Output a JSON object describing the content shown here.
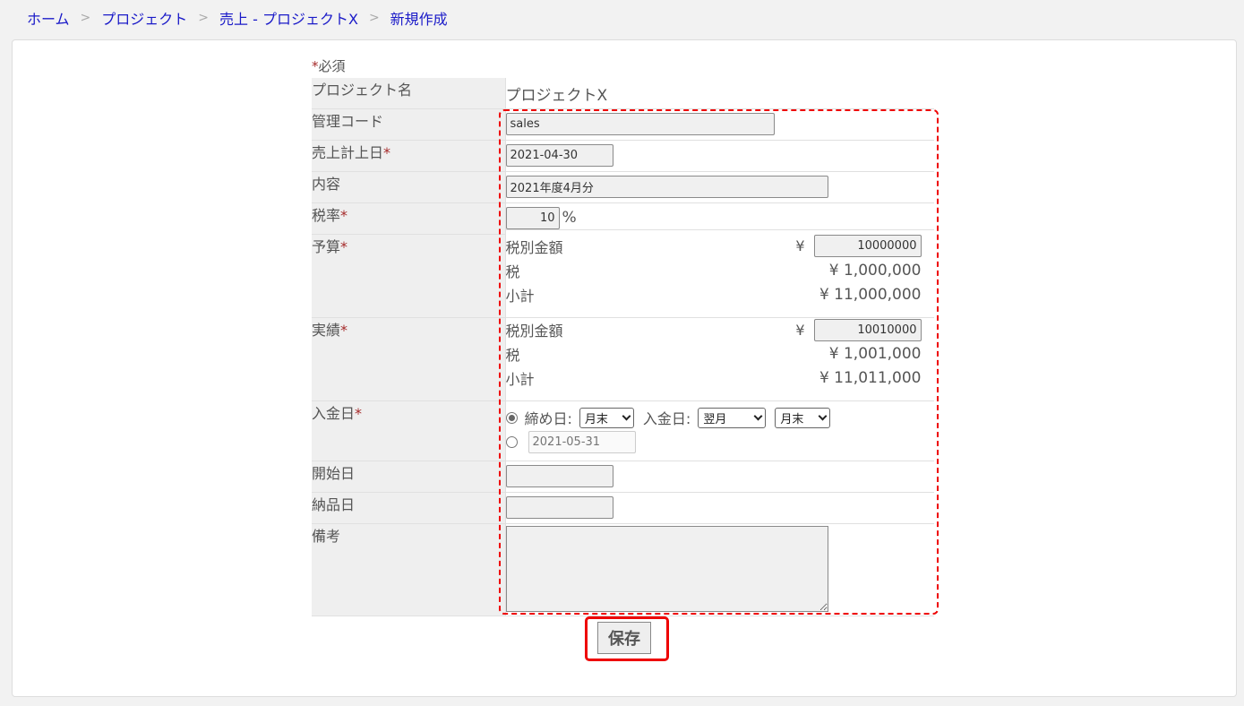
{
  "breadcrumb": {
    "items": [
      "ホーム",
      "プロジェクト",
      "売上 - プロジェクトX",
      "新規作成"
    ],
    "separator": ">"
  },
  "form": {
    "required_mark": "*",
    "required_note": "必須",
    "project_name": {
      "label": "プロジェクト名",
      "value": "プロジェクトX"
    },
    "management_code": {
      "label": "管理コード",
      "value": "sales"
    },
    "sales_date": {
      "label": "売上計上日",
      "value": "2021-04-30"
    },
    "content": {
      "label": "内容",
      "value": "2021年度4月分"
    },
    "tax_rate": {
      "label": "税率",
      "value": "10",
      "unit": "%"
    },
    "budget": {
      "label": "予算",
      "pre_tax_label": "税別金額",
      "currency": "¥",
      "pre_tax_value": "10000000",
      "tax_label": "税",
      "tax_value": "¥ 1,000,000",
      "subtotal_label": "小計",
      "subtotal_value": "¥ 11,000,000"
    },
    "actual": {
      "label": "実績",
      "pre_tax_label": "税別金額",
      "currency": "¥",
      "pre_tax_value": "10010000",
      "tax_label": "税",
      "tax_value": "¥ 1,001,000",
      "subtotal_label": "小計",
      "subtotal_value": "¥ 11,011,000"
    },
    "payment_date": {
      "label": "入金日",
      "closing_label": "締め日:",
      "closing_value": "月末",
      "payment_label": "入金日:",
      "month_value": "翌月",
      "day_value": "月末",
      "fixed_date_placeholder": "2021-05-31"
    },
    "start_date": {
      "label": "開始日",
      "value": ""
    },
    "delivery_date": {
      "label": "納品日",
      "value": ""
    },
    "remarks": {
      "label": "備考",
      "value": ""
    }
  },
  "save_label": "保存",
  "colors": {
    "link": "#1a1ac8",
    "required": "#a52a2a",
    "highlight": "#ee0000"
  }
}
